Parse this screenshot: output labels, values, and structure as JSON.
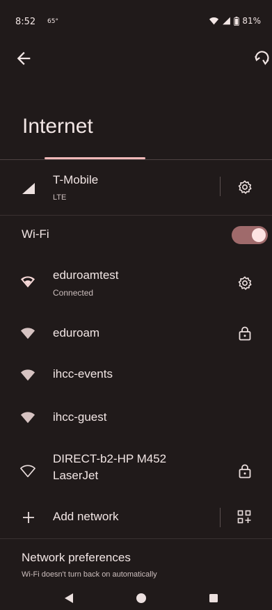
{
  "status_bar": {
    "time": "8:52",
    "temperature": "65°",
    "battery": "81%",
    "icons": [
      "wifi-icon",
      "cell-signal-icon",
      "battery-icon"
    ]
  },
  "header": {
    "back_icon": "arrow-left-icon",
    "help_icon": "refresh-help-icon",
    "title": "Internet"
  },
  "mobile_network": {
    "name": "T-Mobile",
    "type": "LTE",
    "icon": "cell-signal-icon",
    "settings_icon": "gear-icon"
  },
  "wifi": {
    "label": "Wi-Fi",
    "enabled": true
  },
  "networks": [
    {
      "name": "eduroamtest",
      "status": "Connected",
      "icon": "wifi-outline-icon",
      "action_icon": "gear-icon"
    },
    {
      "name": "eduroam",
      "status": "",
      "icon": "wifi-filled-icon",
      "action_icon": "lock-icon"
    },
    {
      "name": "ihcc-events",
      "status": "",
      "icon": "wifi-filled-icon",
      "action_icon": ""
    },
    {
      "name": "ihcc-guest",
      "status": "",
      "icon": "wifi-filled-icon",
      "action_icon": ""
    },
    {
      "name": "DIRECT-b2-HP M452 LaserJet",
      "name_line1": "DIRECT-b2-HP M452",
      "name_line2": "LaserJet",
      "status": "",
      "icon": "wifi-outline-icon",
      "action_icon": "lock-icon"
    }
  ],
  "add_network": {
    "label": "Add network",
    "icon": "plus-icon",
    "qr_icon": "qr-scan-icon"
  },
  "network_preferences": {
    "title": "Network preferences",
    "subtitle": "Wi-Fi doesn't turn back on automatically"
  },
  "nav_bar": {
    "icons": [
      "back-triangle-icon",
      "home-circle-icon",
      "recents-square-icon"
    ]
  },
  "colors": {
    "background": "#201a1a",
    "accent": "#f0b8b8",
    "toggle_track": "#9f6a6b",
    "toggle_knob": "#fde3e2"
  }
}
